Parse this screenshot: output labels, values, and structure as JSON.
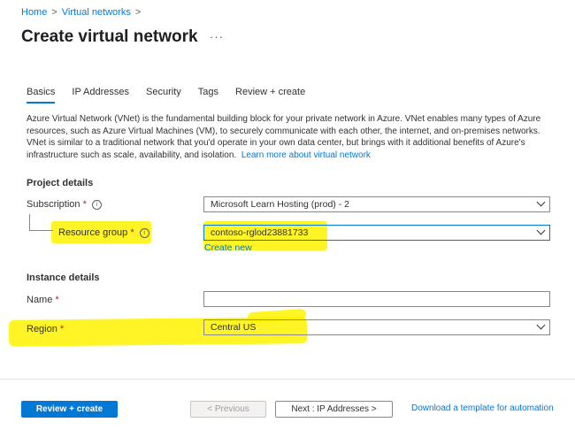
{
  "breadcrumb": {
    "items": [
      "Home",
      "Virtual networks"
    ],
    "sep": ">"
  },
  "header": {
    "title": "Create virtual network",
    "more": "···"
  },
  "tabs": [
    {
      "label": "Basics",
      "active": true
    },
    {
      "label": "IP Addresses"
    },
    {
      "label": "Security"
    },
    {
      "label": "Tags"
    },
    {
      "label": "Review + create"
    }
  ],
  "description": {
    "text": "Azure Virtual Network (VNet) is the fundamental building block for your private network in Azure. VNet enables many types of Azure resources, such as Azure Virtual Machines (VM), to securely communicate with each other, the internet, and on-premises networks. VNet is similar to a traditional network that you'd operate in your own data center, but brings with it additional benefits of Azure's infrastructure such as scale, availability, and isolation.",
    "link": "Learn more about virtual network"
  },
  "project": {
    "heading": "Project details",
    "subscription": {
      "label": "Subscription",
      "value": "Microsoft Learn Hosting (prod) - 2"
    },
    "resource_group": {
      "label": "Resource group",
      "value": "contoso-rglod23881733",
      "create_new": "Create new"
    }
  },
  "instance": {
    "heading": "Instance details",
    "name": {
      "label": "Name",
      "value": ""
    },
    "region": {
      "label": "Region",
      "value": "Central US"
    }
  },
  "footer": {
    "review": "Review + create",
    "previous": "< Previous",
    "next": "Next : IP Addresses >",
    "download": "Download a template for automation"
  },
  "required_mark": "*",
  "info_glyph": "i",
  "colors": {
    "accent": "#0078d4",
    "highlight": "#fff200",
    "required": "#a4262c"
  }
}
